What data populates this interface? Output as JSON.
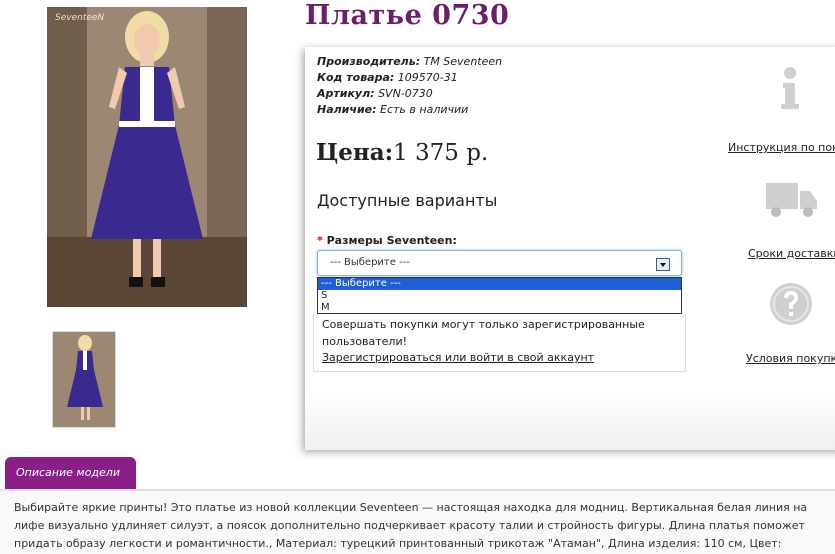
{
  "product": {
    "title": "Платье 0730",
    "photo_watermark": "SeventeeN"
  },
  "specs": [
    {
      "label": "Производитель:",
      "value": "TM Seventeen"
    },
    {
      "label": "Код товара:",
      "value": "109570-31"
    },
    {
      "label": "Артикул:",
      "value": "SVN-0730"
    },
    {
      "label": "Наличие:",
      "value": "Есть в наличии"
    }
  ],
  "price": {
    "label": "Цена:",
    "value": "1 375 р."
  },
  "options": {
    "title": "Доступные варианты",
    "required_mark": "*",
    "size_label": "Размеры Seventeen:",
    "select_value": "--- Выберите ---",
    "dropdown_options": [
      "--- Выберите ---",
      "S",
      "M"
    ]
  },
  "login": {
    "message": "Совершать покупки могут только зарегистрированные пользователи!",
    "link": "Зарегистрироваться или войти в свой аккаунт"
  },
  "side": {
    "instruction": "Инструкция по покупке",
    "delivery": "Сроки доставки",
    "terms": "Условия покупки"
  },
  "tab": {
    "label": "Описание модели"
  },
  "description": "Выбирайте яркие принты! Это платье из новой коллекции Seventeen — настоящая находка для модниц. Вертикальная белая линия на лифе визуально удлиняет силуэт, а поясок дополнительно подчеркивает красоту талии и стройность фигуры. Длина платья поможет придать образу легкости и романтичности., Материал: турецкий принтованный трикотаж \"Атаман\", Длина изделия: 110 см, Цвет: электрик",
  "colors": {
    "title": "#6b1f6b",
    "tab": "#8a1f8a",
    "dress": "#3a2a8f",
    "select_highlight": "#1e5fd6"
  }
}
